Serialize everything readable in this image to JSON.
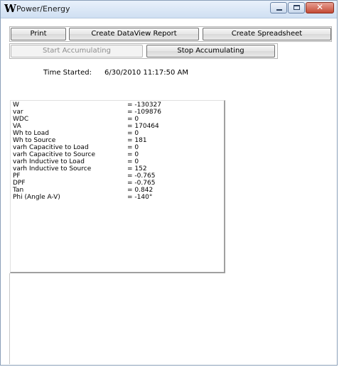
{
  "window": {
    "icon_letter": "W",
    "title": "Power/Energy",
    "controls": {
      "minimize": "minimize-icon",
      "maximize": "maximize-icon",
      "close": "close-icon"
    }
  },
  "toolbar": {
    "print_label": "Print",
    "dataview_label": "Create DataView Report",
    "spreadsheet_label": "Create Spreadsheet",
    "start_label": "Start Accumulating",
    "stop_label": "Stop Accumulating"
  },
  "status": {
    "time_started_label": "Time Started:",
    "time_started_value": "6/30/2010 11:17:50 AM"
  },
  "measurements": [
    {
      "name": "W",
      "value": "= -130327"
    },
    {
      "name": "var",
      "value": "= -109876"
    },
    {
      "name": "WDC",
      "value": "= 0"
    },
    {
      "name": "VA",
      "value": "= 170464"
    },
    {
      "name": "Wh to Load",
      "value": "= 0"
    },
    {
      "name": "Wh to Source",
      "value": "= 181"
    },
    {
      "name": "varh Capacitive to Load",
      "value": "= 0"
    },
    {
      "name": "varh Capacitive to Source",
      "value": "= 0"
    },
    {
      "name": "varh Inductive to Load",
      "value": "= 0"
    },
    {
      "name": "varh Inductive to Source",
      "value": "= 152"
    },
    {
      "name": "PF",
      "value": "= -0.765"
    },
    {
      "name": "DPF",
      "value": "= -0.765"
    },
    {
      "name": "Tan",
      "value": "= 0.842"
    },
    {
      "name": "Phi (Angle A-V)",
      "value": "= -140°"
    }
  ]
}
